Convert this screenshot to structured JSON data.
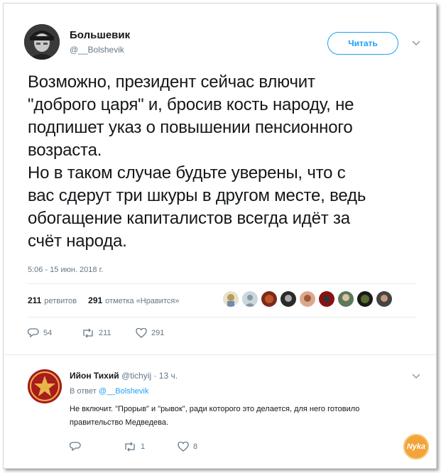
{
  "main_tweet": {
    "author": {
      "name": "Большевик",
      "handle": "@__Bolshevik"
    },
    "follow_label": "Читать",
    "text": "Возможно, президент сейчас влючит\n\"доброго царя\" и, бросив кость народу, не\nподпишет указ о повышении пенсионного\nвозраста.\nНо в таком случае будьте уверены, что с\nвас сдерут три шкуры в другом месте, ведь\nобогащение капиталистов всегда идёт за\nсчёт народа.",
    "timestamp": "5:06 - 15 июн. 2018 г.",
    "stats": {
      "retweets_count": "211",
      "retweets_label": "ретвитов",
      "likes_count": "291",
      "likes_label": "отметка «Нравится»"
    },
    "actions": {
      "replies": "54",
      "retweets": "211",
      "likes": "291"
    }
  },
  "reply_tweet": {
    "author": {
      "name": "Ийон Тихий",
      "handle": "@tichyij",
      "time": "· 13 ч."
    },
    "reply_to_prefix": "В ответ",
    "reply_to_handle": "@__Bolshevik",
    "text": "Не включит. \"Прорыв\" и \"рывок\", ради которого это делается, для него готовило правительство Медведева.",
    "actions": {
      "replies": "",
      "retweets": "1",
      "likes": "8"
    }
  },
  "watermark_text": "Nyka",
  "colors": {
    "accent": "#1da1f2",
    "text": "#14171a",
    "muted": "#657786",
    "divider": "#e6ecf0"
  },
  "icons": [
    "chevron-down-icon",
    "reply-icon",
    "retweet-icon",
    "like-icon"
  ]
}
